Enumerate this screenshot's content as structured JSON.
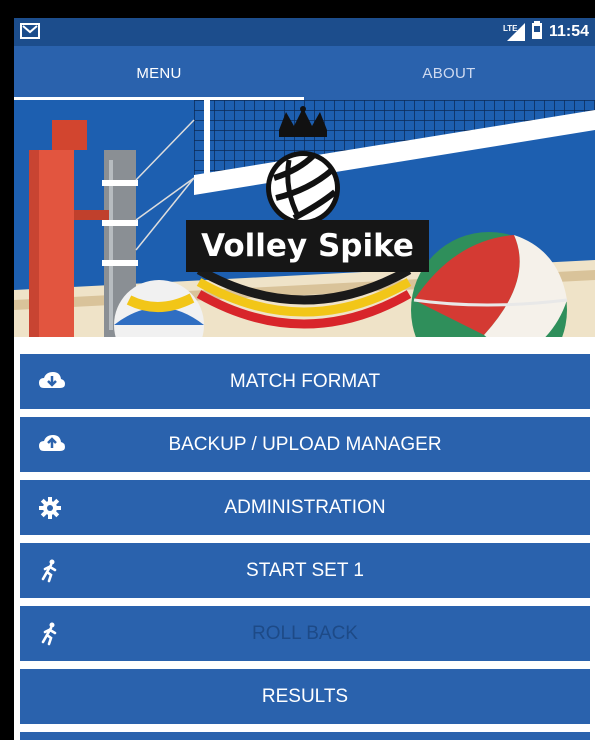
{
  "status_bar": {
    "notification_icon": "gmail-icon",
    "network": "LTE",
    "time": "11:54"
  },
  "tabs": [
    {
      "label": "MENU",
      "selected": true
    },
    {
      "label": "ABOUT",
      "selected": false
    }
  ],
  "banner": {
    "logo_text": "Volley Spike"
  },
  "menu": [
    {
      "label": "MATCH FORMAT",
      "icon": "cloud-download-icon",
      "enabled": true
    },
    {
      "label": "BACKUP / UPLOAD MANAGER",
      "icon": "cloud-upload-icon",
      "enabled": true
    },
    {
      "label": "ADMINISTRATION",
      "icon": "gear-icon",
      "enabled": true
    },
    {
      "label": "START SET 1",
      "icon": "runner-icon",
      "enabled": true
    },
    {
      "label": "ROLL BACK",
      "icon": "runner-icon",
      "enabled": false
    },
    {
      "label": "RESULTS",
      "icon": "",
      "enabled": true
    }
  ],
  "colors": {
    "primary": "#2a62ad",
    "status_bar": "#1c4d8c",
    "disabled_text": "#1d4a87"
  }
}
